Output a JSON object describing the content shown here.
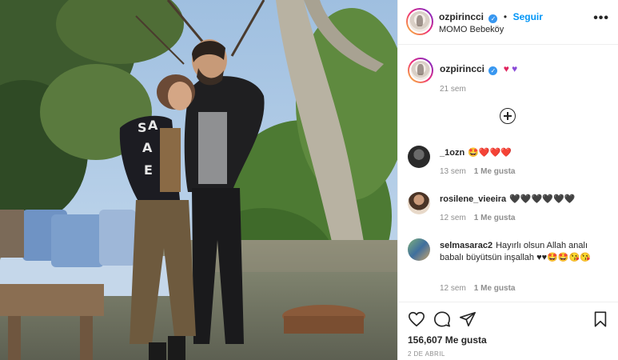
{
  "header": {
    "username": "ozpirincci",
    "follow_label": "Seguir",
    "location": "MOMO Bebeköy",
    "more_label": "•••"
  },
  "caption": {
    "username": "ozpirincci",
    "emojis": [
      "red-heart",
      "purple-heart"
    ],
    "time": "21 sem"
  },
  "comments": [
    {
      "username": "_1ozn",
      "text": "🤩❤️❤️❤️",
      "time": "13 sem",
      "likes": "1 Me gusta"
    },
    {
      "username": "rosilene_vieeira",
      "text": "🖤🖤🖤🖤🖤🖤",
      "time": "12 sem",
      "likes": "1 Me gusta"
    },
    {
      "username": "selmasarac2",
      "text": "Hayırlı olsun Allah analı babalı büyütsün inşallah ♥♥🤩🤩😘😘",
      "time": "12 sem",
      "likes": "1 Me gusta"
    }
  ],
  "actions": {
    "likes_count": "156,607 Me gusta",
    "date": "2 DE ABRIL"
  },
  "icons": {
    "like": "heart-outline-icon",
    "comment": "comment-bubble-icon",
    "share": "paper-plane-icon",
    "save": "bookmark-icon",
    "verified": "verified-badge-icon",
    "load_more": "plus-circle-icon"
  },
  "colors": {
    "link": "#0095f6",
    "verified": "#3897f0",
    "muted": "#8e8e8e",
    "text": "#262626"
  }
}
